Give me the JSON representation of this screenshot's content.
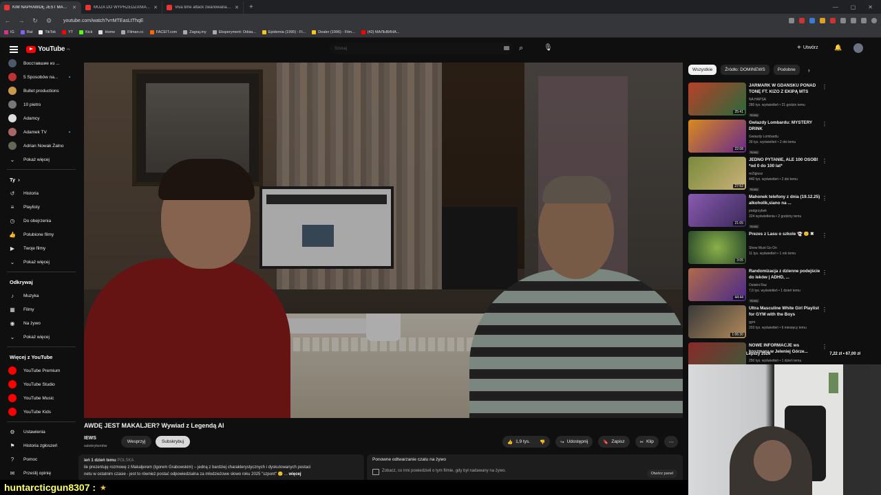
{
  "browser": {
    "tabs": [
      {
        "title": "KIM NAPRAWDĘ JEST MAKALJER",
        "active": true
      },
      {
        "title": "MUZA DO WYPRZEDZANIA BOEING",
        "active": false
      },
      {
        "title": "Viva time attack zwariowana scie",
        "active": false
      }
    ],
    "new_tab": "+",
    "url": "youtube.com/watch?v=MTEasLtThqE",
    "bookmarks": [
      "IG",
      "Rat",
      "TikTok",
      "YT",
      "Kick",
      "Home",
      "Filman.cc",
      "FACEIT.com",
      "Zagraj.my",
      "Eksperyment: Odsia...",
      "Epidemia (1995) - Fi...",
      "Dealer (1996) - Film...",
      "(42) МАЛЬВИНА..."
    ]
  },
  "header": {
    "logo_text": "YouTube",
    "logo_country": "PL",
    "search_placeholder": "Szukaj",
    "create_label": "Utwórz"
  },
  "sidebar": {
    "subscriptions": [
      {
        "label": "Восставшие из ...",
        "dot": false
      },
      {
        "label": "5 Sposobów na...",
        "dot": true
      },
      {
        "label": "Bullet productions",
        "dot": false
      },
      {
        "label": "10 pietro",
        "dot": false
      },
      {
        "label": "Adamcy",
        "dot": false
      },
      {
        "label": "Adamek TV",
        "dot": true
      },
      {
        "label": "Adrian Nowak Żalno",
        "dot": false
      }
    ],
    "show_more_1": "Pokaż więcej",
    "you_header": "Ty",
    "you_items": [
      "Historia",
      "Playlisty",
      "Do obejrzenia",
      "Polubione filmy",
      "Twoje filmy"
    ],
    "show_more_2": "Pokaż więcej",
    "explore_header": "Odkrywaj",
    "explore_items": [
      "Muzyka",
      "Filmy",
      "Na żywo"
    ],
    "show_more_3": "Pokaż więcej",
    "more_header": "Więcej z YouTube",
    "more_items": [
      "YouTube Premium",
      "YouTube Studio",
      "YouTube Music",
      "YouTube Kids"
    ],
    "bottom_items": [
      "Ustawienia",
      "Historia zgłoszeń",
      "Pomoc",
      "Prześlij opinię"
    ]
  },
  "video": {
    "title": "AWDĘ JEST MAKALJER? Wywiad z Legendą AI",
    "channel": "IEWS",
    "channel_sub": "subskrybentów",
    "support_label": "Wesprzyj",
    "subscribe_label": "Subskrybuj",
    "likes": "1,9 tys.",
    "share_label": "Udostępnij",
    "save_label": "Zapisz",
    "clip_label": "Klip",
    "more_label": "⋯",
    "desc_meta": "ień 1 dzień temu",
    "desc_tag": "POLSKA",
    "desc_text": "ile prezentuję rozmowę z Makaljerem (Igorem Grabowskim) – jedną z bardziej charakterystycznych i dyskutowanych postaci",
    "desc_text2": "netu w ostatnim czasie - jest to również postać odpowiedzialna za młodzieżowe słowo roku 2025 \"szpont\" 🙂 ...",
    "desc_more": "więcej",
    "live_title": "Ponowne odtwarzanie czatu na żywo",
    "live_sub": "Zobacz, co inni powiedzieli o tym filmie, gdy był nadawany na żywo.",
    "live_btn": "Otwórz panel"
  },
  "right": {
    "chips": [
      "Wszystkie",
      "Źródło: DOMINEWS",
      "Podobne"
    ],
    "chip_selected": 0,
    "recs": [
      {
        "title": "JARMARK W GDAŃSKU PONAD TONĘ FT. KIZO Z EKIPĄ MTS",
        "channel": "NA HAPSA",
        "views": "280 tys. wyświetleń • 21 godzin temu",
        "badge": "Nowy",
        "duration": "25:41",
        "color": "#a23a2a"
      },
      {
        "title": "Gwiazdy Lombardu: MYSTERY DRINK",
        "channel": "Gwiazdy Lombardu",
        "views": "39 tys. wyświetleń • 2 dni temu",
        "badge": "Nowy",
        "duration": "22:08",
        "color": "#c57a1e"
      },
      {
        "title": "JEDNO PYTANIE, ALE 100 OSÓB! *od 0 do 100 lat*",
        "channel": "reZigiusz",
        "views": "440 tys. wyświetleń • 2 dni temu",
        "badge": "Nowy",
        "duration": "27:52",
        "color": "#6b7b3a"
      },
      {
        "title": "Mahonek telefony z dnia (19.12.25) alkoholik,siano na ...",
        "channel": "podgrzybek",
        "views": "324 wyświetlenia • 2 godziny temu",
        "badge": "Nowy",
        "duration": "21:05",
        "color": "#7a4aa0"
      },
      {
        "title": "Prezes z Lasu o szkole 👻 🙂 ✖",
        "channel": "Show Must Go On",
        "views": "11 tys. wyświetleń • 1 rok temu",
        "badge": "",
        "duration": "3:05",
        "color": "#3c6e3a"
      },
      {
        "title": "Randomizacja z dzienne podejście do leków | ADHD, ...",
        "channel": "Ostatni Raz",
        "views": "7,6 tys. wyświetleń • 1 dzień temu",
        "badge": "Nowy",
        "duration": "44:44",
        "color": "#5a3aa0"
      },
      {
        "title": "Ultra Masculine White Girl Playlist for GYM with the Boys",
        "channel": "gym",
        "views": "203 tys. wyświetleń • 6 miesięcy temu",
        "badge": "",
        "duration": "1:06:30",
        "color": "#8a6a3a"
      },
      {
        "title": "NOWE INFORMACJE ws koszmaru w Jeleniej Górze...",
        "channel": "",
        "views": "250 tys. wyświetleń • 1 dzień temu",
        "badge": "",
        "duration": "",
        "color": "#7a2a2a"
      }
    ],
    "ticker_left": "Lepszy 2026",
    "ticker_right": "7,22 zł • 67,00 zł"
  },
  "chat": {
    "user": "huntarcticgun8307 :",
    "emote": "★"
  }
}
